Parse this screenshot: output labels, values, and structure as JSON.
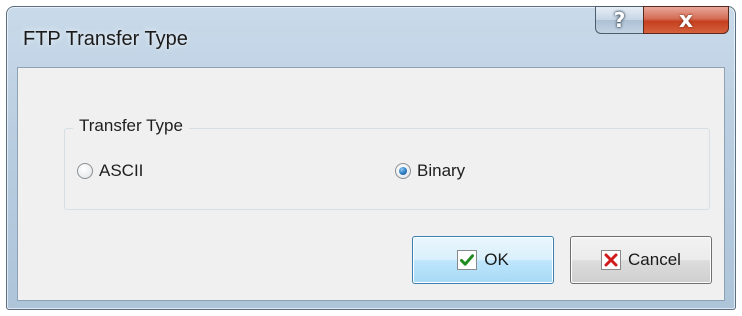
{
  "window": {
    "title": "FTP Transfer Type",
    "help_label": "?",
    "close_label": "x"
  },
  "group": {
    "label": "Transfer Type",
    "options": [
      {
        "label": "ASCII",
        "selected": false
      },
      {
        "label": "Binary",
        "selected": true
      }
    ]
  },
  "buttons": {
    "ok_label": "OK",
    "cancel_label": "Cancel"
  },
  "colors": {
    "check_icon": "#1f8a1f",
    "cancel_icon": "#d01c1c",
    "close_button": "#c4401f"
  },
  "icons": {
    "ok": "check-icon",
    "cancel": "x-icon"
  }
}
